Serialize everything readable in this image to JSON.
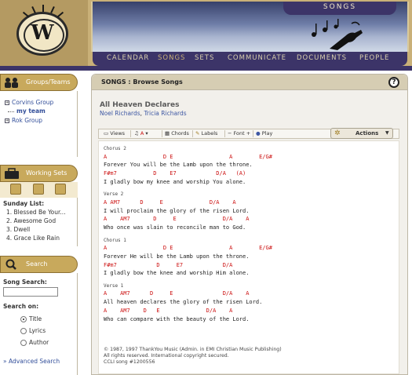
{
  "header": {
    "logo_letter": "W",
    "banner_title": "SONGS"
  },
  "nav": {
    "items": [
      "CALENDAR",
      "SONGS",
      "SETS",
      "COMMUNICATE",
      "DOCUMENTS",
      "PEOPLE"
    ],
    "active": "SONGS"
  },
  "groups_panel": {
    "title": "Groups/Teams",
    "items": [
      {
        "label": "Corvins Group",
        "expander": "+"
      },
      {
        "label": "my team",
        "expander": ""
      },
      {
        "label": "Rok Group",
        "expander": "+"
      }
    ]
  },
  "worksets_panel": {
    "title": "Working Sets",
    "list_title": "Sunday List:",
    "items": [
      "1. Blessed Be Your...",
      "2. Awesome God",
      "3. Dwell",
      "4. Grace Like Rain"
    ]
  },
  "search_panel": {
    "title": "Search",
    "song_search_label": "Song Search:",
    "song_search_value": "",
    "search_on_label": "Search on:",
    "options": [
      "Title",
      "Lyrics",
      "Author"
    ],
    "selected": "Title",
    "advanced_link": "» Advanced Search"
  },
  "main": {
    "breadcrumb": "SONGS : Browse Songs",
    "help_label": "?",
    "song_title": "All Heaven Declares",
    "author1": "Noel Richards",
    "author_sep": ", ",
    "author2": "Tricia Richards"
  },
  "toolbar": {
    "views": "Views",
    "key": "A",
    "chords": "Chords",
    "labels": "Labels",
    "font": "Font",
    "play": "Play",
    "actions": "Actions"
  },
  "sheet": {
    "lines": [
      {
        "type": "sec",
        "text": "Chorus 2"
      },
      {
        "type": "chord",
        "text": "A                 D E                 A        E/G#"
      },
      {
        "type": "lyric",
        "text": "Forever You will be the Lamb upon the throne."
      },
      {
        "type": "chord",
        "text": "F#m7           D    E7            D/A   (A)"
      },
      {
        "type": "lyric",
        "text": "I gladly bow my knee and worship You alone."
      },
      {
        "type": "gap",
        "text": ""
      },
      {
        "type": "sec",
        "text": "Verse 2"
      },
      {
        "type": "chord",
        "text": "A AM7      D     E              D/A    A"
      },
      {
        "type": "lyric",
        "text": "I will proclaim the glory of the risen Lord."
      },
      {
        "type": "chord",
        "text": "A    AM7       D     E              D/A    A"
      },
      {
        "type": "lyric",
        "text": "Who once was slain to reconcile man to God."
      },
      {
        "type": "gap",
        "text": ""
      },
      {
        "type": "sec",
        "text": "Chorus 1"
      },
      {
        "type": "chord",
        "text": "A                 D E                 A        E/G#"
      },
      {
        "type": "lyric",
        "text": "Forever He will be the Lamb upon the throne."
      },
      {
        "type": "chord",
        "text": "F#m7            D     E7            D/A"
      },
      {
        "type": "lyric",
        "text": "I gladly bow the knee and worship Him alone."
      },
      {
        "type": "gap",
        "text": ""
      },
      {
        "type": "sec",
        "text": "Verse 1"
      },
      {
        "type": "chord",
        "text": "A    AM7      D     E               D/A    A"
      },
      {
        "type": "lyric",
        "text": "All heaven declares the glory of the risen Lord."
      },
      {
        "type": "chord",
        "text": "A    AM7    D   E              D/A    A"
      },
      {
        "type": "lyric",
        "text": "Who can compare with the beauty of the Lord."
      }
    ],
    "copyright": [
      "© 1987, 1997 ThankYou Music (Admin. in EMI Christian Music Publishing)",
      "All rights reserved. International copyright secured.",
      "CCLI song #1200556"
    ]
  },
  "colors": {
    "accent_gold": "#c8a95c",
    "nav_purple": "#3c3468",
    "chord_red": "#cc1111",
    "link_blue": "#334f9a"
  }
}
